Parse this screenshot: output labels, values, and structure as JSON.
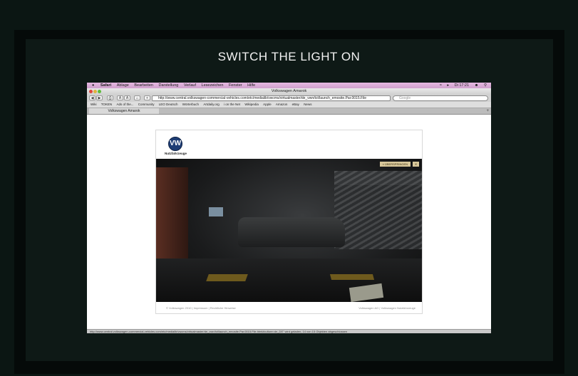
{
  "headline": "SWITCH THE LIGHT ON",
  "mac_menubar": {
    "apple": "",
    "app_name": "Safari",
    "items": [
      "Ablage",
      "Bearbeiten",
      "Darstellung",
      "Verlauf",
      "Lesezeichen",
      "Fenster",
      "Hilfe"
    ],
    "clock": "Di 17:21"
  },
  "browser": {
    "window_title": "Volkswagen Amarok",
    "url": "http://www.central.volkswagen-commercial-vehicles.com/etc/medialib/vwcms/virtualmaster/de_vwn/tct/launch_emosite.Par.0015.File",
    "search_placeholder": "Google",
    "bookmarks": [
      "Wiki",
      "TOKEN",
      "Ads of the...",
      "Community",
      "LEO Deutsch",
      "Wörterbuch",
      "Artdaily.org",
      "i on the Net",
      "Wikipedia",
      "Apple",
      "Amazon",
      "eBay",
      "News"
    ],
    "tab_title": "Volkswagen Amarok",
    "status_text": "http://www.central.volkswagen-commercial-vehicles.com/etc/medialib/vwcms/virtualmaster/de_vwn/tct/launch_emosite.Par.0015.File.html#culture=de_DE\" wird geladen, 14 von 15 Objekten abgeschlossen"
  },
  "vw_page": {
    "logo_glyph": "VW",
    "brand_sub": "Nutzfahrzeuge",
    "skip_label": "» ÜBERSPRINGEN",
    "skip_close": "✕",
    "footer_left": "© Volkswagen 2010  |  Impressum  |  Rechtliche Hinweise",
    "footer_right": "Volkswagen AG  |  Volkswagen Nutzfahrzeuge"
  }
}
